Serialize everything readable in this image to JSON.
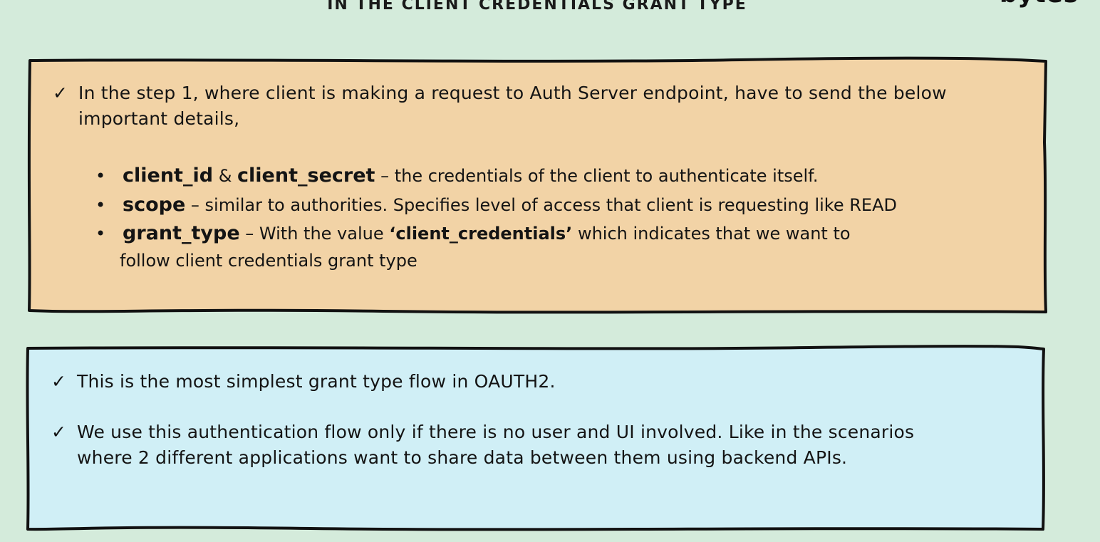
{
  "header": {
    "title": "IN THE CLIENT CREDENTIALS GRANT TYPE",
    "brand": "bytes"
  },
  "colors": {
    "background": "#d4ebdb",
    "orange_box": "#f2d3a6",
    "blue_box": "#d0eff6",
    "border": "#111111"
  },
  "step_box": {
    "intro": {
      "line1": "In the step 1, where client is making a request to Auth Server endpoint, have to send the below",
      "line2": "important details,"
    },
    "bullets": [
      {
        "term1": "client_id",
        "amp": "&",
        "term2": "client_secret",
        "desc": "– the credentials of the client to authenticate itself."
      },
      {
        "term": "scope",
        "desc": "– similar to authorities. Specifies level of access that client is requesting like READ"
      },
      {
        "term": "grant_type",
        "desc_pre": "– With the value",
        "value": "‘client_credentials’",
        "desc_post": "which indicates that we want to",
        "line2": "follow client credentials grant type"
      }
    ]
  },
  "notes_box": {
    "item1": "This is the most simplest grant type flow in OAUTH2.",
    "item2": {
      "line1": "We use this authentication flow only if there is no user and UI involved. Like in the scenarios",
      "line2": "where 2 different applications want to share data between them using backend APIs."
    }
  },
  "icons": {
    "check": "✓",
    "bullet": "•"
  }
}
